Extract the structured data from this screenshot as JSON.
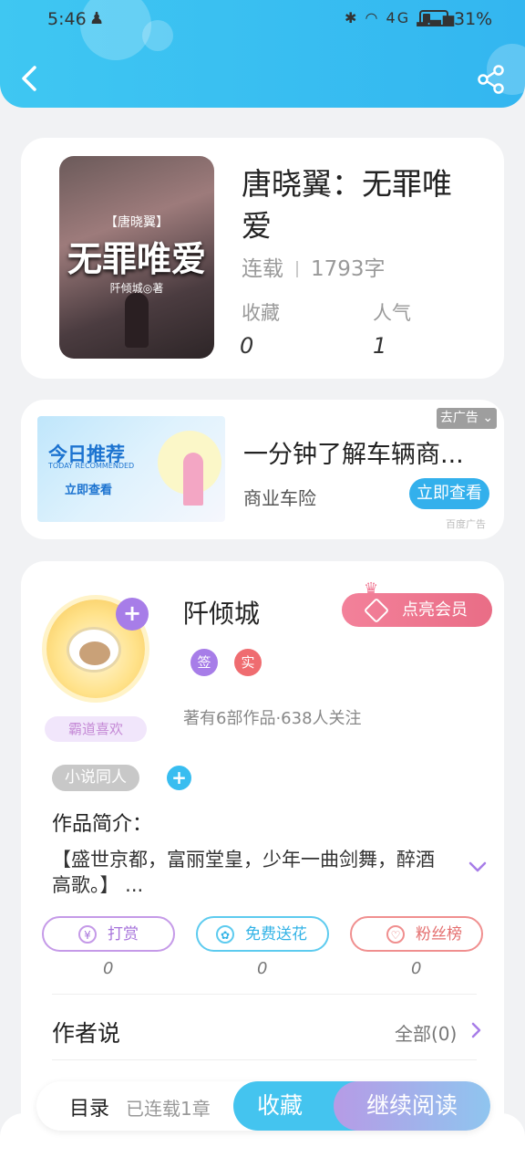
{
  "status_bar": {
    "time": "5:46",
    "network": "4G",
    "battery": "31%"
  },
  "book": {
    "cover_text_top": "【唐晓翼】",
    "cover_title": "无罪唯爱",
    "cover_author": "阡倾城◎著",
    "title": "唐晓翼：无罪唯爱",
    "status": "连载",
    "word_count": "1793字",
    "collect_label": "收藏",
    "collect_value": "0",
    "popularity_label": "人气",
    "popularity_value": "1"
  },
  "ad": {
    "tag": "去广告",
    "image_title": "今日推荐",
    "image_subtitle": "TODAY RECOMMENDED",
    "image_cta": "立即查看",
    "title": "一分钟了解车辆商...",
    "subtitle": "商业车险",
    "button": "立即查看",
    "source": "百度广告"
  },
  "author": {
    "name": "阡倾城",
    "medal": "霸道喜欢",
    "vip_button": "点亮会员",
    "badge_sign": "签",
    "badge_real": "实",
    "stats": "著有6部作品·638人关注",
    "category_chip": "小说同人",
    "intro_title": "作品简介：",
    "intro_text": "【盛世京都，富丽堂皇，少年一曲剑舞，醉酒高歌。】 ...",
    "actions": [
      {
        "label": "打赏",
        "icon": "yen-icon",
        "count": "0"
      },
      {
        "label": "免费送花",
        "icon": "flower-icon",
        "count": "0"
      },
      {
        "label": "粉丝榜",
        "icon": "fan-icon",
        "count": "0"
      }
    ],
    "say_title": "作者说",
    "say_all": "全部(0)"
  },
  "nav": {
    "catalog": "目录",
    "chapters": "已连载1章",
    "collect": "收藏",
    "continue": "继续阅读"
  }
}
